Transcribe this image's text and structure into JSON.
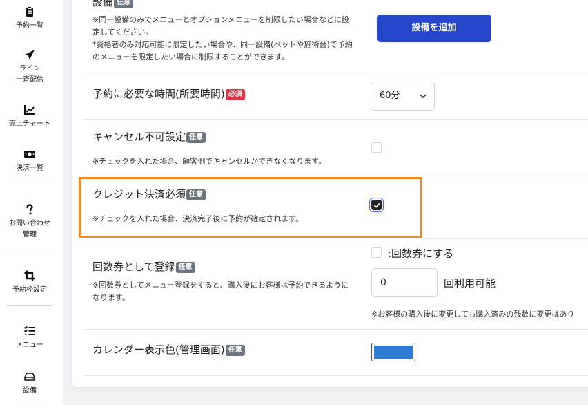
{
  "sidebar": {
    "items": [
      {
        "label": "予約一覧",
        "icon": "clipboard-icon"
      },
      {
        "label": "ライン\n一斉配信",
        "icon": "paper-plane-icon"
      },
      {
        "label": "売上チャート",
        "icon": "chart-line-icon"
      },
      {
        "label": "決済一覧",
        "icon": "money-bill-icon"
      },
      {
        "label": "お問い合わせ\n管理",
        "icon": "question-icon"
      },
      {
        "label": "予約枠設定",
        "icon": "crop-icon"
      },
      {
        "label": "メニュー",
        "icon": "list-check-icon"
      },
      {
        "label": "設備",
        "icon": "hdd-icon"
      }
    ]
  },
  "form": {
    "equipment": {
      "label": "設備",
      "badge": "任意",
      "note1": "※同一設備のみでメニューとオプションメニューを制限したい場合などに設定してください。",
      "note2": "*資格者のみ対応可能に限定したい場合や、同一設備(ベットや施術台)で予約のメニューを限定したい場合に制限することができます。",
      "button": "設備を追加"
    },
    "duration": {
      "label": "予約に必要な時間(所要時間)",
      "badge": "必須",
      "select_value": "60分"
    },
    "cancel": {
      "label": "キャンセル不可設定",
      "badge": "任意",
      "note": "※チェックを入れた場合、顧客側でキャンセルができなくなります。"
    },
    "credit": {
      "label": "クレジット決済必須",
      "badge": "任意",
      "note": "※チェックを入れた場合、決済完了後に予約が確定されます。"
    },
    "ticket": {
      "label": "回数券として登録",
      "badge": "任意",
      "note": "※回数券としてメニュー登録をすると、購入後にお客様は予約できるようになります。",
      "checkbox_label": ":回数券にする",
      "count_value": "0",
      "count_suffix": "回利用可能",
      "warning": "※お客様の購入後に変更しても購入済みの残数に変更はあり"
    },
    "calendar": {
      "label": "カレンダー表示色(管理画面)",
      "badge": "任意",
      "color": "#2f7bd6"
    }
  }
}
